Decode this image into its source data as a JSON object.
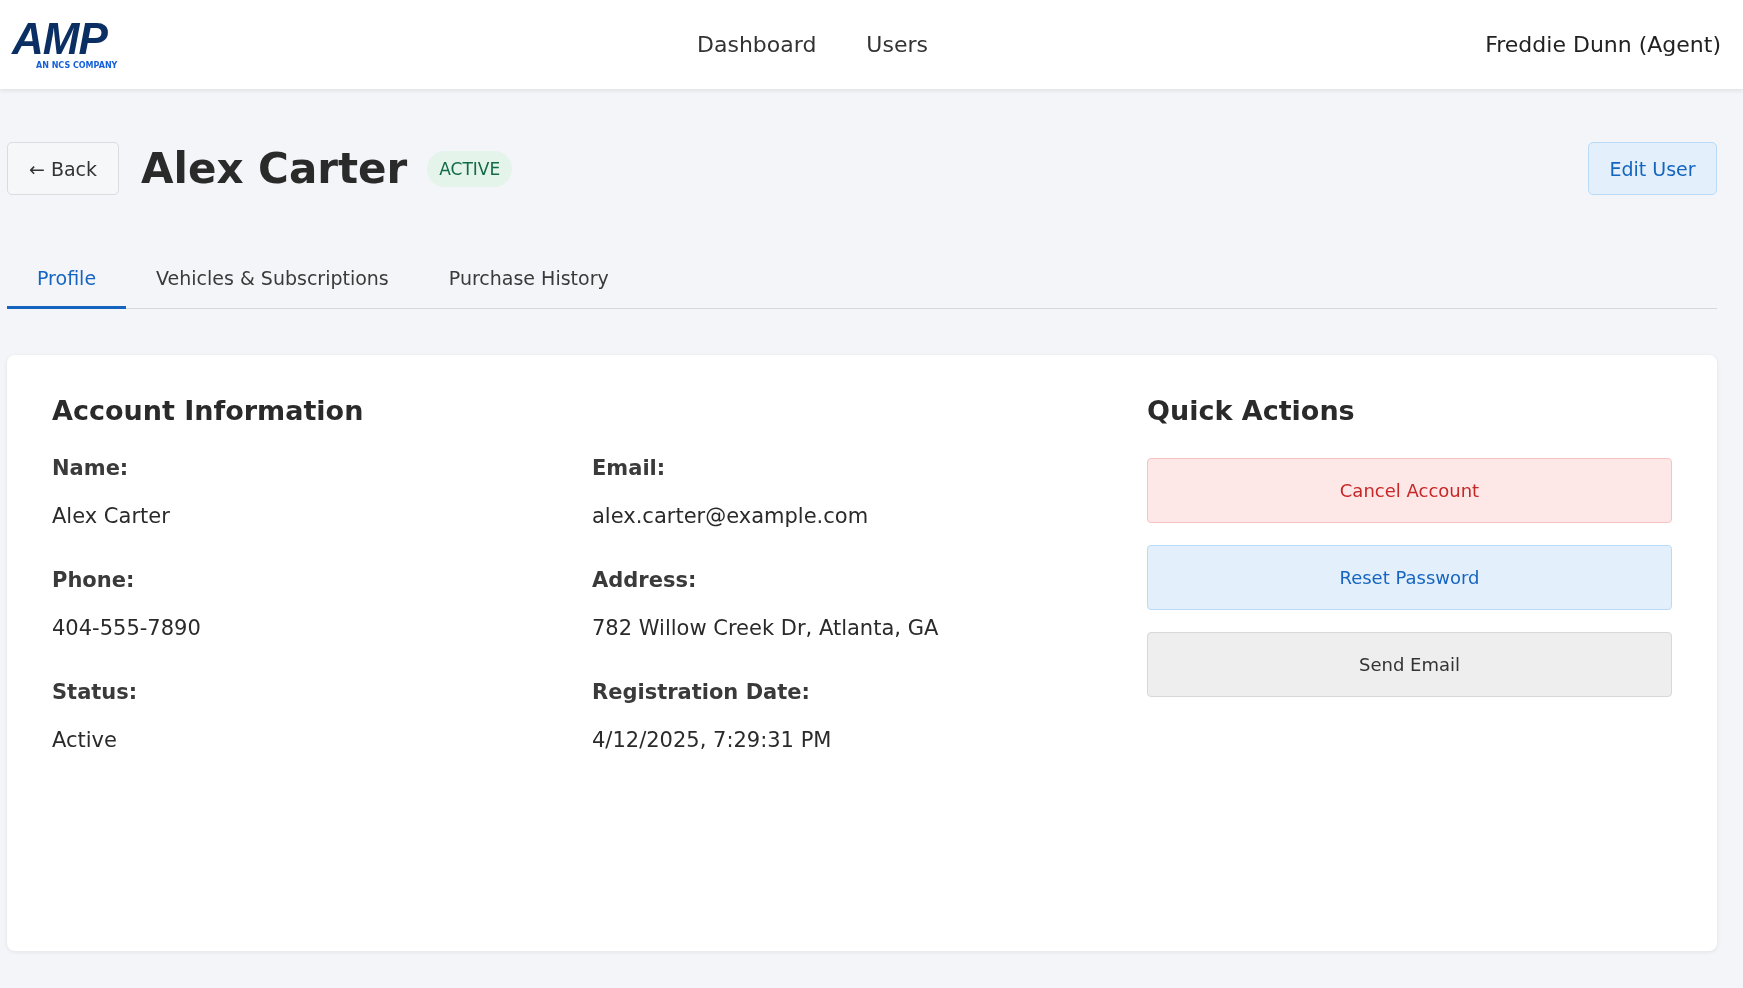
{
  "header": {
    "logo": {
      "mark": "AMP",
      "tagline": "AN NCS COMPANY"
    },
    "nav": [
      {
        "label": "Dashboard"
      },
      {
        "label": "Users"
      }
    ],
    "user": "Freddie Dunn (Agent)"
  },
  "page": {
    "back": "← Back",
    "title": "Alex Carter",
    "status_badge": "ACTIVE",
    "edit_button": "Edit User"
  },
  "tabs": [
    {
      "label": "Profile",
      "selected": true
    },
    {
      "label": "Vehicles & Subscriptions",
      "selected": false
    },
    {
      "label": "Purchase History",
      "selected": false
    }
  ],
  "account": {
    "heading": "Account Information",
    "fields": [
      {
        "label": "Name:",
        "value": "Alex Carter"
      },
      {
        "label": "Email:",
        "value": "alex.carter@example.com"
      },
      {
        "label": "Phone:",
        "value": "404-555-7890"
      },
      {
        "label": "Address:",
        "value": "782 Willow Creek Dr, Atlanta, GA"
      },
      {
        "label": "Status:",
        "value": "Active"
      },
      {
        "label": "Registration Date:",
        "value": "4/12/2025, 7:29:31 PM"
      }
    ]
  },
  "quick_actions": {
    "heading": "Quick Actions",
    "buttons": [
      {
        "label": "Cancel Account",
        "kind": "danger"
      },
      {
        "label": "Reset Password",
        "kind": "primary"
      },
      {
        "label": "Send Email",
        "kind": "neutral"
      }
    ]
  }
}
